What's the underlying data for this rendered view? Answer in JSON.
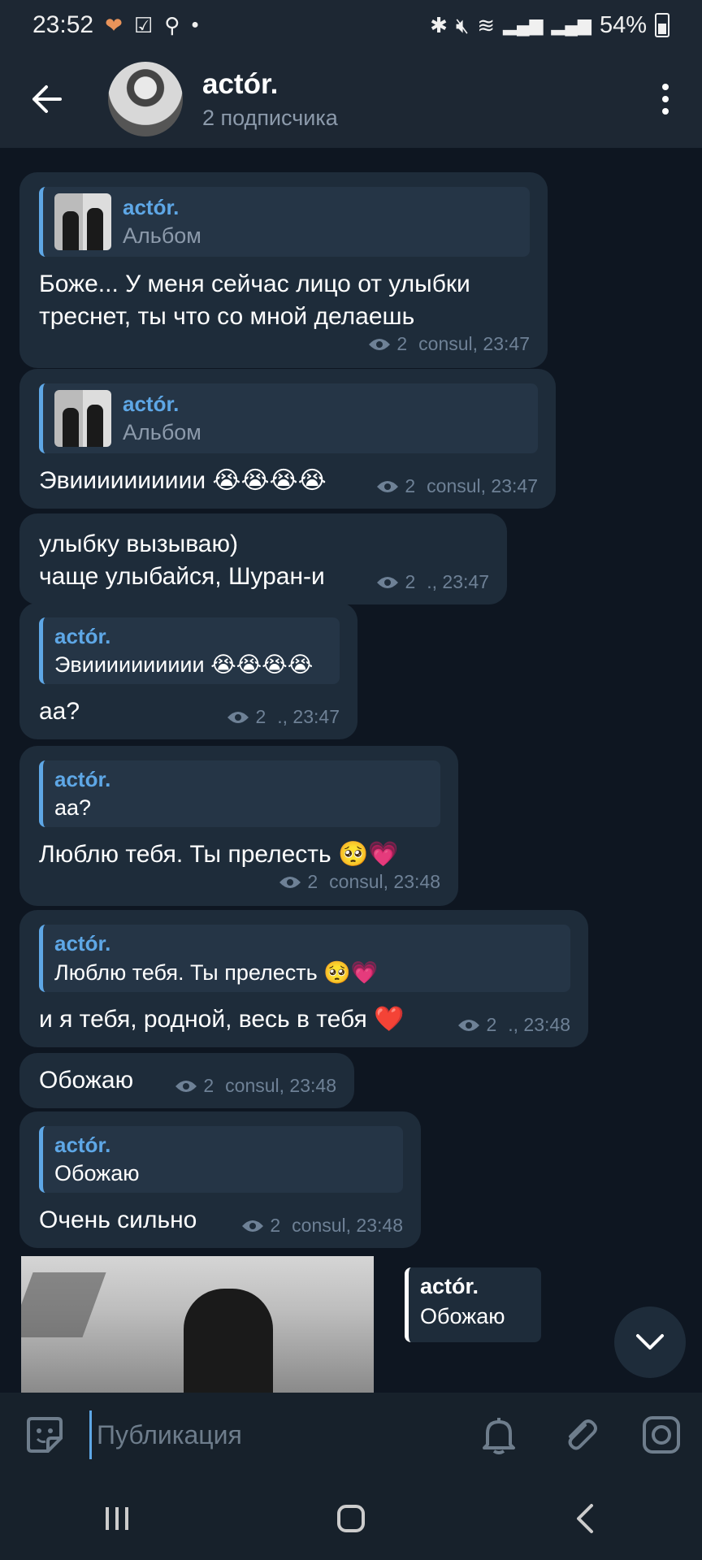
{
  "status_bar": {
    "time": "23:52",
    "battery": "54%"
  },
  "header": {
    "title": "actór.",
    "subtitle": "2 подписчика"
  },
  "messages": [
    {
      "reply_name": "actór.",
      "reply_text": "Альбом",
      "text": "Боже... У меня сейчас лицо от улыбки треснет, ты что со мной делаешь",
      "views": "2",
      "meta": "consul, 23:47"
    },
    {
      "reply_name": "actór.",
      "reply_text": "Альбом",
      "text": "Эвииииииииии 😭😭😭😭",
      "views": "2",
      "meta": "consul, 23:47"
    },
    {
      "text_line1": "улыбку вызываю)",
      "text_line2": "чаще улыбайся, Шуран-и",
      "views": "2",
      "meta": "., 23:47"
    },
    {
      "reply_name": "actór.",
      "reply_text": "Эвииииииииии 😭😭😭😭",
      "text": "аа?",
      "views": "2",
      "meta": "., 23:47"
    },
    {
      "reply_name": "actór.",
      "reply_text": "аа?",
      "text": "Люблю тебя. Ты прелесть 🥺💗",
      "views": "2",
      "meta": "consul, 23:48"
    },
    {
      "reply_name": "actór.",
      "reply_text": "Люблю тебя. Ты прелесть 🥺💗",
      "text": "и я тебя, родной, весь в тебя ❤️",
      "views": "2",
      "meta": "., 23:48"
    },
    {
      "text": "Обожаю",
      "views": "2",
      "meta": "consul, 23:48"
    },
    {
      "reply_name": "actór.",
      "reply_text": "Обожаю",
      "text": "Очень сильно",
      "views": "2",
      "meta": "consul, 23:48"
    }
  ],
  "video_reply": {
    "name": "actór.",
    "text": "Обожаю"
  },
  "input": {
    "placeholder": "Публикация"
  }
}
